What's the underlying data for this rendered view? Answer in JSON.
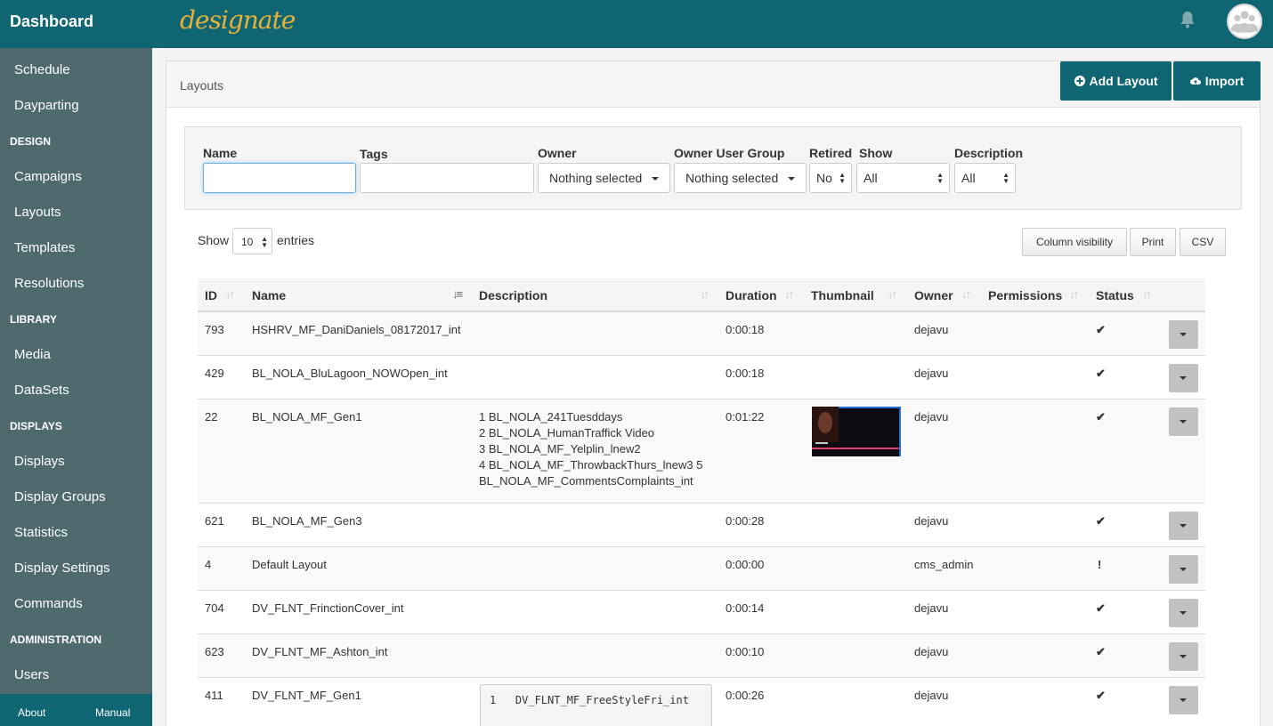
{
  "app": {
    "brand": "Dashboard",
    "logo_text": "designate"
  },
  "sidebar": {
    "items": [
      {
        "type": "link",
        "label": "Schedule"
      },
      {
        "type": "link",
        "label": "Dayparting"
      },
      {
        "type": "header",
        "label": "DESIGN"
      },
      {
        "type": "link",
        "label": "Campaigns"
      },
      {
        "type": "link",
        "label": "Layouts"
      },
      {
        "type": "link",
        "label": "Templates"
      },
      {
        "type": "link",
        "label": "Resolutions"
      },
      {
        "type": "header",
        "label": "LIBRARY"
      },
      {
        "type": "link",
        "label": "Media"
      },
      {
        "type": "link",
        "label": "DataSets"
      },
      {
        "type": "header",
        "label": "DISPLAYS"
      },
      {
        "type": "link",
        "label": "Displays"
      },
      {
        "type": "link",
        "label": "Display Groups"
      },
      {
        "type": "link",
        "label": "Statistics"
      },
      {
        "type": "link",
        "label": "Display Settings"
      },
      {
        "type": "link",
        "label": "Commands"
      },
      {
        "type": "header",
        "label": "ADMINISTRATION"
      },
      {
        "type": "link",
        "label": "Users"
      }
    ],
    "footer": {
      "about": "About",
      "manual": "Manual"
    }
  },
  "page": {
    "title": "Layouts",
    "add_button": "Add Layout",
    "import_button": "Import"
  },
  "filters": {
    "name_label": "Name",
    "name_value": "",
    "tags_label": "Tags",
    "tags_value": "",
    "owner_label": "Owner",
    "owner_value": "Nothing selected",
    "owner_group_label": "Owner User Group",
    "owner_group_value": "Nothing selected",
    "retired_label": "Retired",
    "retired_value": "No",
    "show_label": "Show",
    "show_value": "All",
    "description_label": "Description",
    "description_value": "All"
  },
  "table_controls": {
    "show_label": "Show",
    "entries_value": "10",
    "entries_label": "entries",
    "column_visibility": "Column visibility",
    "print": "Print",
    "csv": "CSV"
  },
  "table": {
    "columns": [
      "ID",
      "Name",
      "Description",
      "Duration",
      "Thumbnail",
      "Owner",
      "Permissions",
      "Status"
    ],
    "rows": [
      {
        "id": "793",
        "name": "HSHRV_MF_DaniDaniels_08172017_int",
        "description": "",
        "duration": "0:00:18",
        "owner": "dejavu",
        "status": "✔"
      },
      {
        "id": "429",
        "name": "BL_NOLA_BluLagoon_NOWOpen_int",
        "description": "",
        "duration": "0:00:18",
        "owner": "dejavu",
        "status": "✔"
      },
      {
        "id": "22",
        "name": "BL_NOLA_MF_Gen1",
        "description_lines": [
          "1 BL_NOLA_241Tuesddays",
          "2 BL_NOLA_HumanTraffick Video",
          "3 BL_NOLA_MF_Yelplin_lnew2",
          "4 BL_NOLA_MF_ThrowbackThurs_lnew3 5",
          "BL_NOLA_MF_CommentsComplaints_int"
        ],
        "duration": "0:01:22",
        "owner": "dejavu",
        "status": "✔"
      },
      {
        "id": "621",
        "name": "BL_NOLA_MF_Gen3",
        "description": "",
        "duration": "0:00:28",
        "owner": "dejavu",
        "status": "✔"
      },
      {
        "id": "4",
        "name": "Default Layout",
        "description": "",
        "duration": "0:00:00",
        "owner": "cms_admin",
        "status": "!"
      },
      {
        "id": "704",
        "name": "DV_FLNT_FrinctionCover_int",
        "description": "",
        "duration": "0:00:14",
        "owner": "dejavu",
        "status": "✔"
      },
      {
        "id": "623",
        "name": "DV_FLNT_MF_Ashton_int",
        "description": "",
        "duration": "0:00:10",
        "owner": "dejavu",
        "status": "✔"
      },
      {
        "id": "411",
        "name": "DV_FLNT_MF_Gen1",
        "description_code": "1   DV_FLNT_MF_FreeStyleFri_int",
        "duration": "0:00:26",
        "owner": "dejavu",
        "status": "✔"
      }
    ]
  },
  "colors": {
    "topbar": "#0f6572",
    "sidebar": "#4e6a6e",
    "logo": "#e6b23a"
  }
}
